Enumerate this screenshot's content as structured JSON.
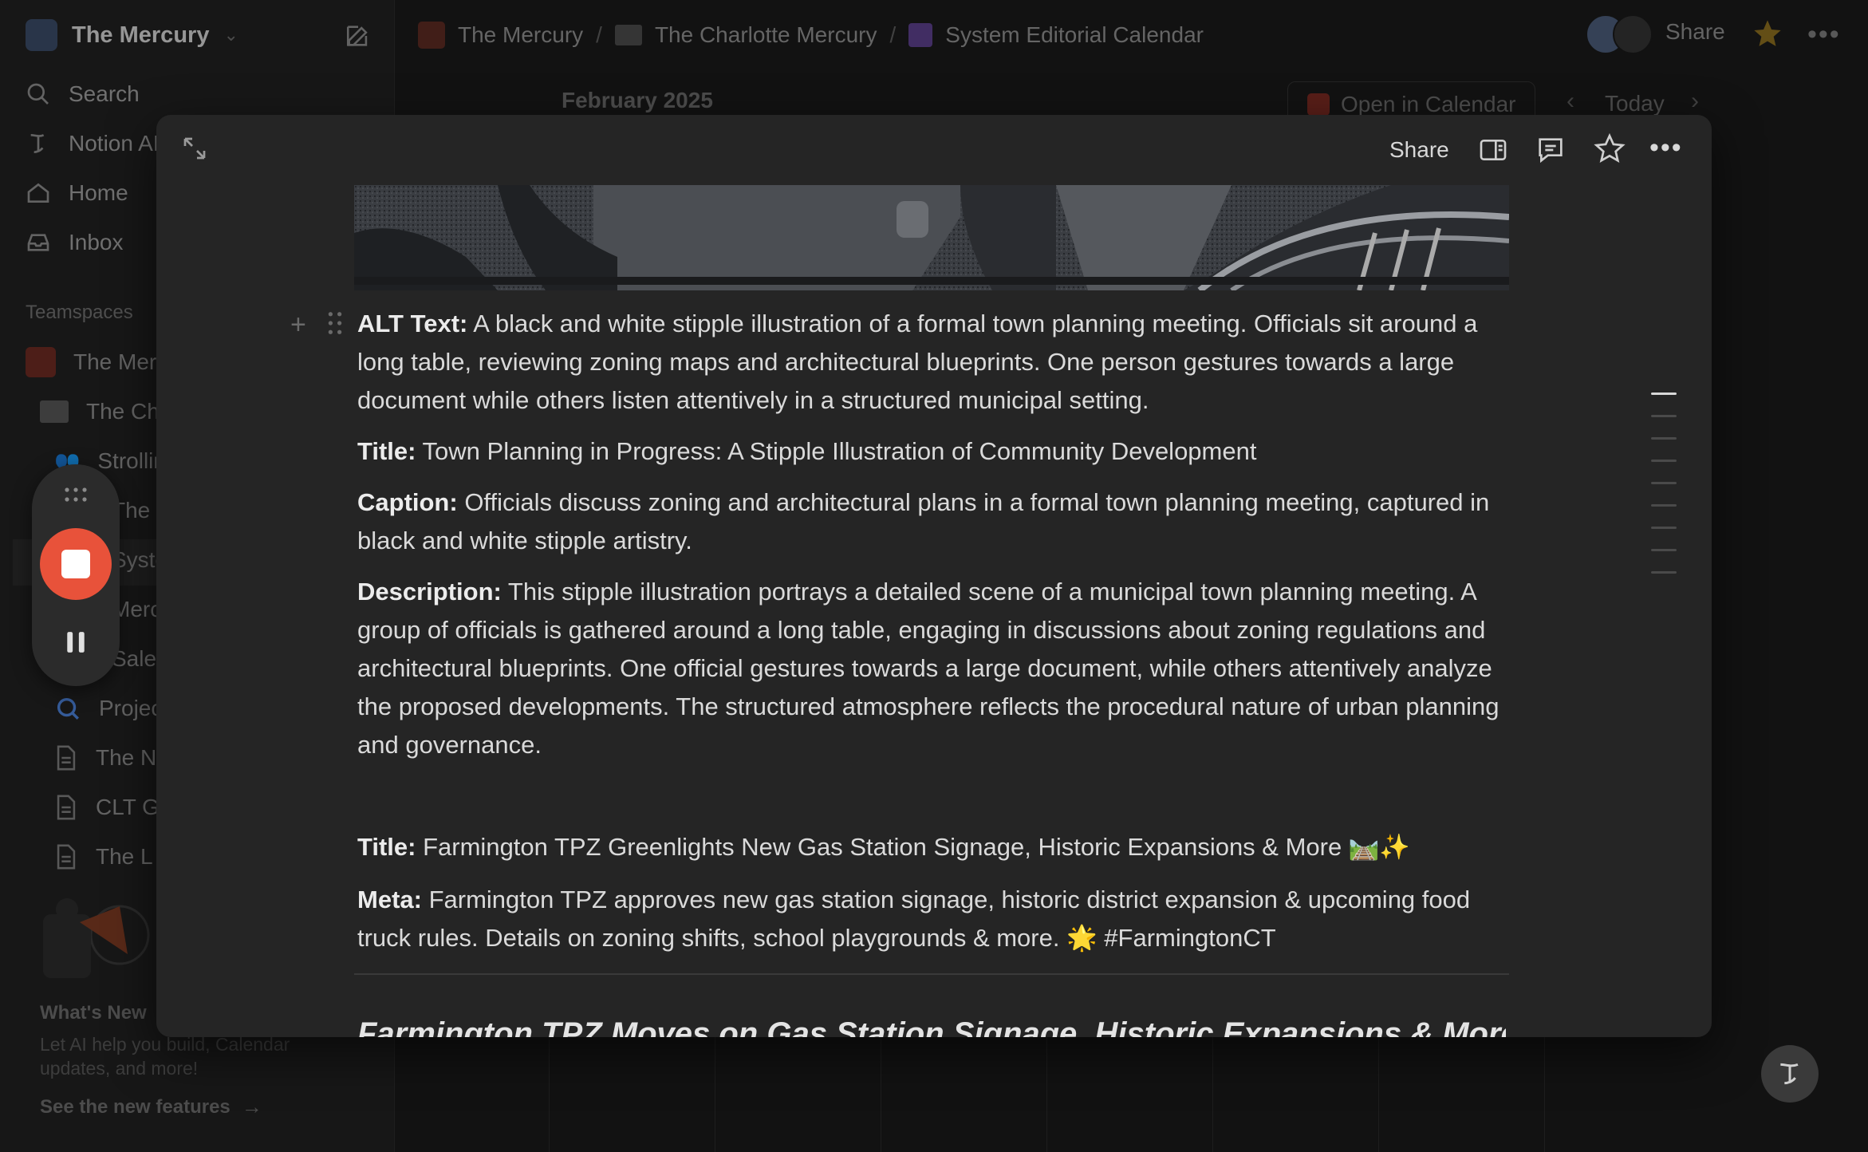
{
  "workspace": {
    "name": "The Mercury"
  },
  "sidebar": {
    "nav": [
      {
        "label": "Search",
        "icon": "search-icon"
      },
      {
        "label": "Notion AI",
        "icon": "notion-ai-icon"
      },
      {
        "label": "Home",
        "icon": "home-icon"
      },
      {
        "label": "Inbox",
        "icon": "inbox-icon"
      }
    ],
    "teamspaces_label": "Teamspaces",
    "tree": [
      "The Mercury",
      "The Charlotte Mercury",
      "Strolling",
      "The F",
      "System",
      "Mercury",
      "Sales",
      "Projects",
      "The N",
      "CLT G",
      "The L"
    ],
    "whats_new": {
      "title": "What's New",
      "body": "Let AI help you build, Calendar updates, and more!",
      "link": "See the new features"
    }
  },
  "topbar": {
    "breadcrumbs": [
      "The Mercury",
      "The Charlotte Mercury",
      "System Editorial Calendar"
    ],
    "share_label": "Share"
  },
  "calendar": {
    "month": "February 2025",
    "open_in_calendar": "Open in Calendar",
    "today": "Today"
  },
  "modal": {
    "share_label": "Share",
    "blocks": {
      "alt_label": "ALT Text:",
      "alt_text": " A black and white stipple illustration of a formal town planning meeting. Officials sit around a long table, reviewing zoning maps and architectural blueprints. One person gestures towards a large document while others listen attentively in a structured municipal setting.",
      "title1_label": "Title:",
      "title1_text": " Town Planning in Progress: A Stipple Illustration of Community Development",
      "caption_label": "Caption:",
      "caption_text": " Officials discuss zoning and architectural plans in a formal town planning meeting, captured in black and white stipple artistry.",
      "desc_label": "Description:",
      "desc_text": " This stipple illustration portrays a detailed scene of a municipal town planning meeting. A group of officials is gathered around a long table, engaging in discussions about zoning regulations and architectural blueprints. One official gestures towards a large document, while others attentively analyze the proposed developments. The structured atmosphere reflects the procedural nature of urban planning and governance.",
      "title2_label": "Title:",
      "title2_text": " Farmington TPZ Greenlights New Gas Station Signage, Historic Expansions & More 🛤️✨",
      "meta_label": "Meta:",
      "meta_text": " Farmington TPZ approves new gas station signage, historic district expansion & upcoming food truck rules. Details on zoning shifts, school playgrounds & more. 🌟 #FarmingtonCT",
      "heading": "Farmington TPZ Moves on Gas Station Signage, Historic Expansions & More"
    }
  },
  "colors": {
    "record_button": "#e8523a",
    "star_active": "#c9a227",
    "background": "#191919",
    "modal": "#252525"
  }
}
